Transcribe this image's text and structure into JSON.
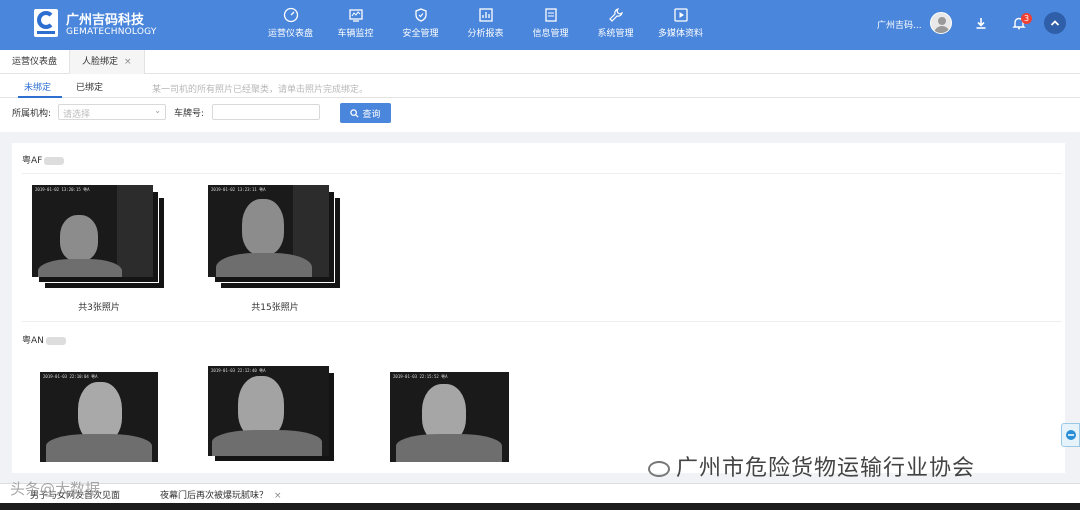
{
  "app": {
    "brand_name": "广州吉码科技",
    "brand_sub": "GEMATECHNOLOGY"
  },
  "nav": [
    {
      "label": "运营仪表盘",
      "icon": "dashboard-icon"
    },
    {
      "label": "车辆监控",
      "icon": "monitor-icon"
    },
    {
      "label": "安全管理",
      "icon": "shield-icon"
    },
    {
      "label": "分析报表",
      "icon": "chart-icon"
    },
    {
      "label": "信息管理",
      "icon": "document-icon"
    },
    {
      "label": "系统管理",
      "icon": "wrench-icon"
    },
    {
      "label": "多媒体资料",
      "icon": "media-icon"
    }
  ],
  "header": {
    "user_name": "广州吉码...",
    "notification_count": "3"
  },
  "tabs": [
    {
      "label": "运营仪表盘"
    },
    {
      "label": "人脸绑定",
      "close": "×"
    }
  ],
  "subtabs": {
    "unbound": "未绑定",
    "bound": "已绑定",
    "hint": "某一司机的所有照片已经聚类，请单击照片完成绑定。"
  },
  "filters": {
    "org_label": "所属机构:",
    "org_placeholder": "请选择",
    "plate_label": "车牌号:",
    "query_label": "查询"
  },
  "groups": [
    {
      "plate": "粤AF",
      "captions": [
        "共3张照片",
        "共15张照片"
      ]
    },
    {
      "plate": "粤AN"
    }
  ],
  "overlay": {
    "watermark": "广州市危险货物运输行业协会",
    "watermark2": "头条@大数据",
    "news1": "男子与女网友首次见面",
    "news2": "夜幕门后再次被爆玩腻味？",
    "close": "×"
  },
  "photo_timestamps": {
    "p1": "2019-01-02 13:20:15 粤A",
    "p2": "2019-01-02 13:23:11 粤A",
    "p3": "2019-01-03 22:10:04 粤A",
    "p4": "2019-01-03 22:12:40 粤A",
    "p5": "2019-01-03 22:15:52 粤A"
  }
}
